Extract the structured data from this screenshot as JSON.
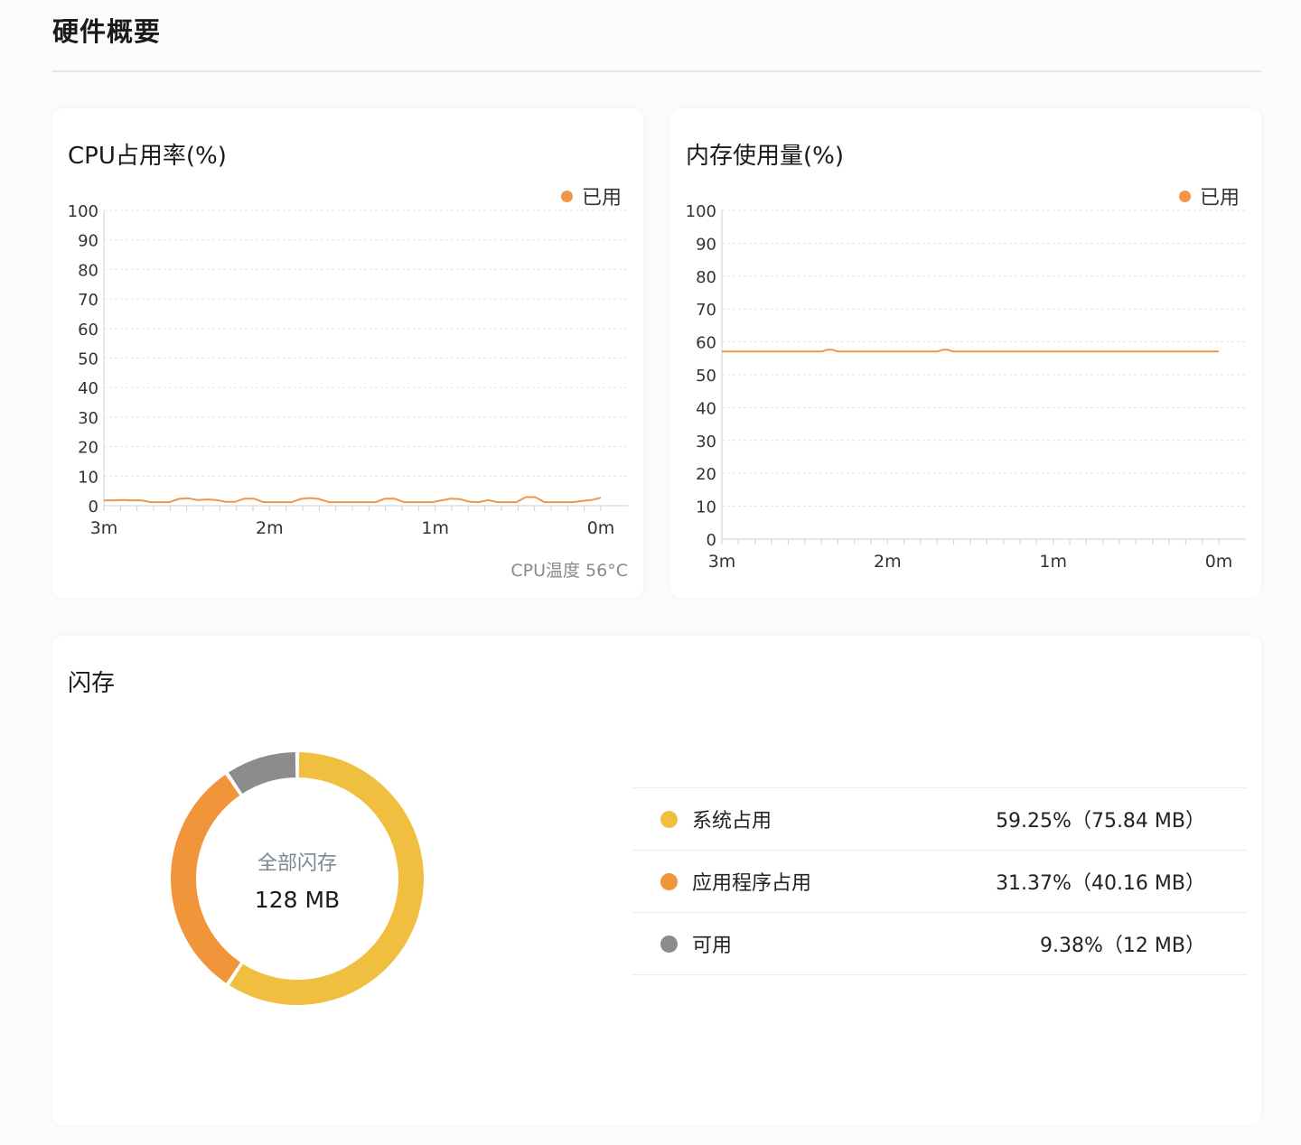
{
  "page": {
    "title": "硬件概要"
  },
  "cpu": {
    "title": "CPU占用率(%)",
    "legend": "已用",
    "temperature": "CPU温度 56°C",
    "colors": {
      "line": "#f0954a"
    },
    "chart_data": {
      "type": "line",
      "title": "CPU占用率(%)",
      "ylim": [
        0,
        100
      ],
      "yticks": [
        0,
        10,
        20,
        30,
        40,
        50,
        60,
        70,
        80,
        90,
        100
      ],
      "xtick_labels": [
        "3m",
        "2m",
        "1m",
        "0m"
      ],
      "grid": true,
      "legend_position": "top-right",
      "series": [
        {
          "name": "已用",
          "color": "#f0954a",
          "values": [
            1.8,
            1.8,
            1.9,
            1.8,
            1.8,
            1.2,
            1.2,
            1.2,
            2.3,
            2.5,
            1.9,
            2.1,
            1.9,
            1.3,
            1.3,
            2.4,
            2.4,
            1.2,
            1.2,
            1.2,
            1.2,
            2.3,
            2.6,
            2.2,
            1.2,
            1.2,
            1.2,
            1.2,
            1.2,
            1.2,
            2.4,
            2.4,
            1.2,
            1.2,
            1.2,
            1.2,
            1.8,
            2.4,
            2.2,
            1.3,
            1.2,
            1.9,
            1.2,
            1.2,
            1.2,
            2.9,
            2.9,
            1.2,
            1.2,
            1.2,
            1.2,
            1.6,
            1.9,
            2.7
          ]
        }
      ]
    }
  },
  "memory": {
    "title": "内存使用量(%)",
    "legend": "已用",
    "colors": {
      "line": "#f0954a"
    },
    "chart_data": {
      "type": "line",
      "title": "内存使用量(%)",
      "ylim": [
        0,
        100
      ],
      "yticks": [
        0,
        10,
        20,
        30,
        40,
        50,
        60,
        70,
        80,
        90,
        100
      ],
      "xtick_labels": [
        "3m",
        "2m",
        "1m",
        "0m"
      ],
      "grid": true,
      "legend_position": "top-right",
      "series": [
        {
          "name": "已用",
          "color": "#f0954a",
          "values": [
            57.1,
            57.1,
            57.1,
            57.1,
            57.1,
            57.1,
            57.1,
            57.1,
            57.1,
            57.1,
            57.1,
            57.1,
            57.1,
            57.1,
            57.1,
            57.1,
            57.1,
            57.1,
            57.1,
            57.1,
            57.1,
            57.6,
            57.6,
            57.1,
            57.1,
            57.1,
            57.1,
            57.1,
            57.1,
            57.1,
            57.1,
            57.1,
            57.1,
            57.1,
            57.1,
            57.1,
            57.1,
            57.1,
            57.1,
            57.1,
            57.1,
            57.1,
            57.1,
            57.1,
            57.6,
            57.6,
            57.1,
            57.1,
            57.1,
            57.1,
            57.1,
            57.1,
            57.1,
            57.1,
            57.1,
            57.1,
            57.1,
            57.1,
            57.1,
            57.1,
            57.1,
            57.1,
            57.1,
            57.1,
            57.1,
            57.1,
            57.1,
            57.1,
            57.1,
            57.1,
            57.1,
            57.1,
            57.1,
            57.1,
            57.1,
            57.1,
            57.1,
            57.1,
            57.1,
            57.1,
            57.1,
            57.1,
            57.1,
            57.1,
            57.1,
            57.1,
            57.1,
            57.1,
            57.1,
            57.1,
            57.1,
            57.1,
            57.1,
            57.1,
            57.1,
            57.1,
            57.1,
            57.1,
            57.1,
            57.1
          ]
        }
      ]
    }
  },
  "flash": {
    "title": "闪存",
    "center_label": "全部闪存",
    "center_value": "128 MB",
    "rows": [
      {
        "name": "系统占用",
        "value": "59.25%（75.84 MB）",
        "color": "#f0bf3f"
      },
      {
        "name": "应用程序占用",
        "value": "31.37%（40.16 MB）",
        "color": "#f0953a"
      },
      {
        "name": "可用",
        "value": "9.38%（12 MB）",
        "color": "#8c8c8c"
      }
    ],
    "chart_data": {
      "type": "pie",
      "title": "",
      "categories": [
        "系统占用",
        "应用程序占用",
        "可用"
      ],
      "values": [
        59.25,
        31.37,
        9.38
      ],
      "colors": [
        "#f0bf3f",
        "#f0953a",
        "#8c8c8c"
      ]
    }
  }
}
